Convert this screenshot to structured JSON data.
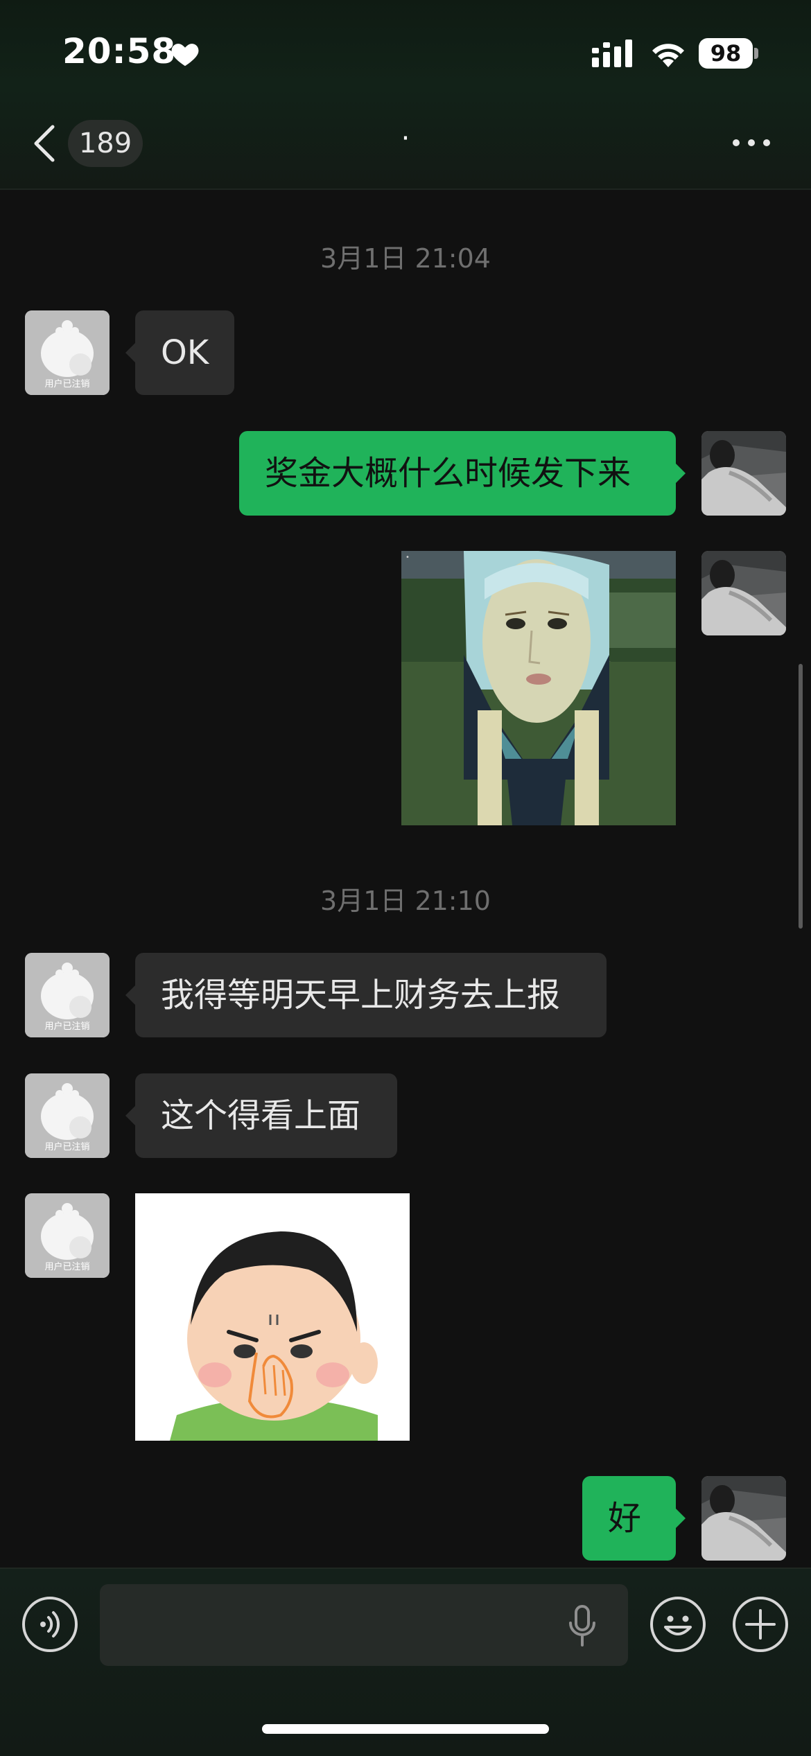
{
  "status_bar": {
    "time": "20:58",
    "battery": "98"
  },
  "nav": {
    "unread_count": "189",
    "title": "·"
  },
  "messages": {
    "timestamp_1": "3月1日 21:04",
    "msg_1_text": "OK",
    "msg_2_text": "奖金大概什么时候发下来",
    "timestamp_2": "3月1日 21:10",
    "msg_4_text": "我得等明天早上财务去上报",
    "msg_5_text": "这个得看上面",
    "msg_7_text": "好",
    "deactivated_avatar_label": "用户已注销"
  },
  "input": {
    "placeholder": ""
  },
  "colors": {
    "sent_bubble": "#20b35a",
    "received_bubble": "#2c2c2c",
    "background": "#111111"
  },
  "icons": {
    "heart": "heart-icon",
    "signal": "signal-icon",
    "wifi": "wifi-icon",
    "back": "back-arrow-icon",
    "more": "more-dots-icon",
    "voice": "voice-icon",
    "mic": "mic-icon",
    "emoji": "emoji-icon",
    "plus": "plus-icon"
  }
}
